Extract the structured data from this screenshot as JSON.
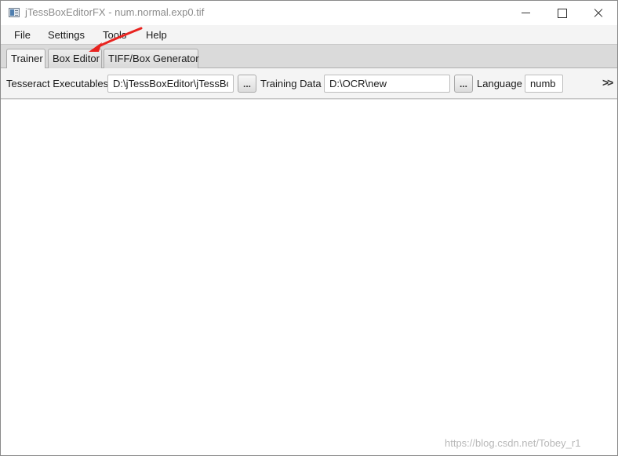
{
  "window": {
    "title": "jTessBoxEditorFX - num.normal.exp0.tif"
  },
  "menu": {
    "items": [
      "File",
      "Settings",
      "Tools",
      "Help"
    ]
  },
  "tabs": [
    {
      "label": "Trainer",
      "selected": true
    },
    {
      "label": "Box Editor",
      "selected": false
    },
    {
      "label": "TIFF/Box Generator",
      "selected": false
    }
  ],
  "toolbar": {
    "tesseract_label": "Tesseract Executables",
    "tesseract_value": "D:\\jTessBoxEditor\\jTessBc",
    "browse_label": "...",
    "training_label": "Training Data",
    "training_value": "D:\\OCR\\new",
    "language_label": "Language",
    "language_value": "numb",
    "overflow_label": ">>"
  },
  "annotation": {
    "arrow_color": "#e8231f"
  },
  "watermark": "https://blog.csdn.net/Tobey_r1"
}
